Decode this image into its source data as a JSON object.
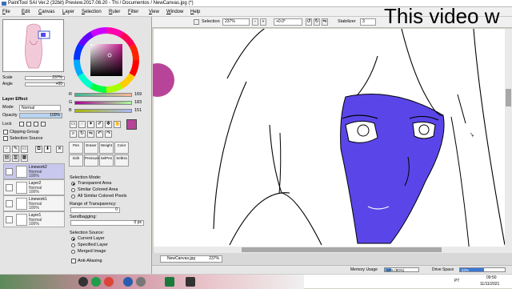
{
  "window": {
    "title": "PaintTool SAI Ver.2 (32bit) Preview.2017.08.20 - Thi / Documentos / NewCanvas.jpg (*)"
  },
  "watermark": "This video w",
  "menu": [
    "File",
    "Edit",
    "Canvas",
    "Layer",
    "Selection",
    "Ruler",
    "Filter",
    "View",
    "Window",
    "Help"
  ],
  "toolbar": {
    "selection_label": "Selection",
    "zoom": "237%",
    "rotation": "+0.0°",
    "stabilizer_label": "Stabilizer",
    "stabilizer_value": "3"
  },
  "navigator": {
    "scale_label": "Scale",
    "scale_value": "237%",
    "angle_label": "Angle",
    "angle_value": "+00"
  },
  "layer_effect": {
    "header": "Layer Effect",
    "mode_label": "Mode",
    "mode_value": "Normal",
    "opacity_label": "Opacity",
    "opacity_value": "100%",
    "lock_label": "Lock",
    "clipping_group": "Clipping Group",
    "selection_source": "Selection Source"
  },
  "color": {
    "current": "#b8449a",
    "r_label": "R",
    "r_value": "169",
    "g_label": "G",
    "g_value": "183",
    "b_label": "B",
    "b_value": "151"
  },
  "layers": [
    {
      "name": "Linework2",
      "mode": "Normal",
      "opacity": "100%",
      "active": true
    },
    {
      "name": "Layer2",
      "mode": "Normal",
      "opacity": "100%",
      "active": false
    },
    {
      "name": "Linework1",
      "mode": "Normal",
      "opacity": "100%",
      "active": false
    },
    {
      "name": "Layer1",
      "mode": "Normal",
      "opacity": "100%",
      "active": false
    }
  ],
  "brushes": [
    {
      "label": "Pen"
    },
    {
      "label": "Eraser"
    },
    {
      "label": "Weight"
    },
    {
      "label": "Color"
    },
    {
      "label": "Edit"
    },
    {
      "label": "Pressure"
    },
    {
      "label": "SelPen"
    },
    {
      "label": "SelEra"
    }
  ],
  "selection_panel": {
    "mode_header": "Selection Mode:",
    "modes": [
      "Transparent Area",
      "Similar Colored Area",
      "All Similar Colored Pixels"
    ],
    "range_label": "Range of Transparency:",
    "range_value": "0",
    "sandbagging_label": "Sandbagging:",
    "sandbagging_value": "0 px",
    "source_header": "Selection Source:",
    "sources": [
      "Current Layer",
      "Specified Layer",
      "Merged Image"
    ],
    "antialias": "Anti-Aliasing"
  },
  "document": {
    "tab_name": "NewCanvas.jpg",
    "tab_zoom": "237%"
  },
  "status": {
    "memory_label": "Memory Usage",
    "memory_value": "20% (90%)",
    "memory_fill": 0.2,
    "drive_label": "Drive Space",
    "drive_value": "53%",
    "drive_fill": 0.53
  },
  "taskbar": {
    "lang": "PT",
    "time": "09:50",
    "date": "11/11/2021"
  },
  "colors": {
    "face_fill": "#5a46e8",
    "accent_purple": "#b8449a",
    "memory_bar": "#5aa0e8",
    "drive_bar": "#3a78d8"
  }
}
